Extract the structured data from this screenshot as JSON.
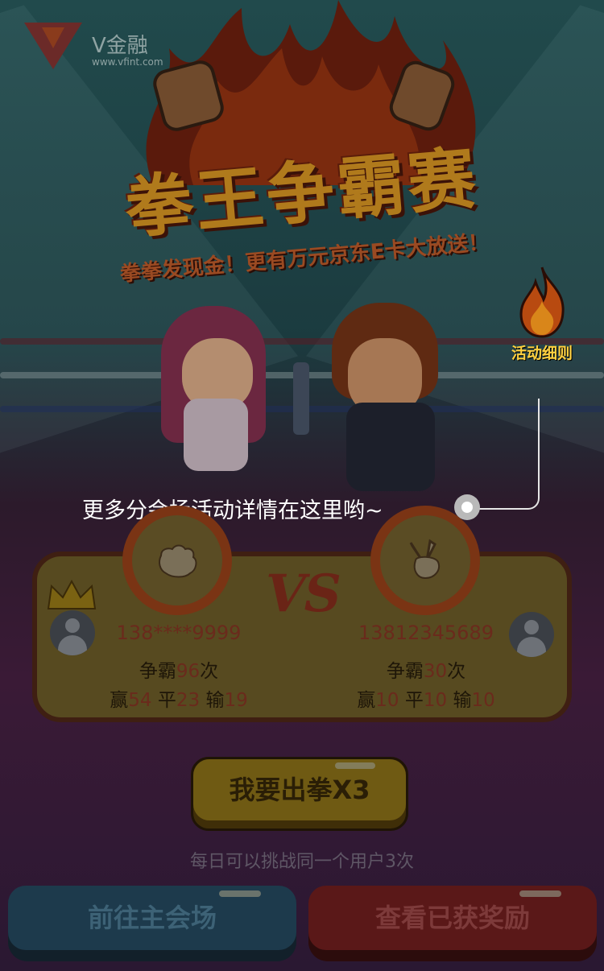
{
  "brand": {
    "name": "V金融",
    "url": "www.vfint.com"
  },
  "banner": {
    "title": "拳王争霸赛",
    "subtitle": "拳拳发现金！更有万元京东E卡大放送！"
  },
  "rules": {
    "label": "活动细则"
  },
  "guide": {
    "text": "更多分会场活动详情在这里哟~"
  },
  "vs": {
    "label": "VS"
  },
  "players": [
    {
      "name": "138****9999",
      "battles_prefix": "争霸",
      "battles": "96",
      "battles_suffix": "次",
      "win_label": "赢",
      "win": "54",
      "draw_label": "平",
      "draw": "23",
      "lose_label": "输",
      "lose": "19",
      "hand": "rock-icon",
      "crown": true
    },
    {
      "name": "13812345689",
      "battles_prefix": "争霸",
      "battles": "30",
      "battles_suffix": "次",
      "win_label": "赢",
      "win": "10",
      "draw_label": "平",
      "draw": "10",
      "lose_label": "输",
      "lose": "10",
      "hand": "scissors-icon",
      "crown": false
    }
  ],
  "actions": {
    "punch_label": "我要出拳X3",
    "daily_limit": "每日可以挑战同一个用户3次",
    "main_venue_label": "前往主会场",
    "rewards_label": "查看已获奖励"
  },
  "colors": {
    "primary": "#6f5a13",
    "main_venue": "#1d3a4c",
    "rewards": "#5a1818",
    "accent": "#ffd040"
  }
}
